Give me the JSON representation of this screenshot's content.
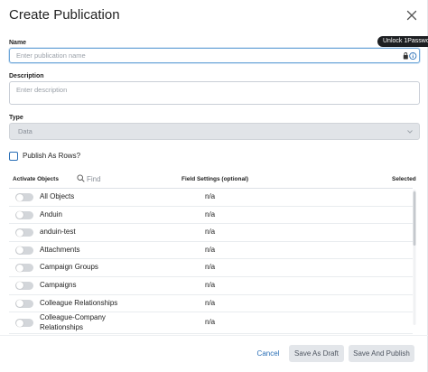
{
  "dialog": {
    "title": "Create Publication",
    "close_icon": "close-icon"
  },
  "name_field": {
    "label": "Name",
    "placeholder": "Enter publication name",
    "value": ""
  },
  "password_manager": {
    "tooltip": "Unlock 1Passwo",
    "icons": [
      "lock-icon",
      "info-icon"
    ]
  },
  "description_field": {
    "label": "Description",
    "placeholder": "Enter description",
    "value": ""
  },
  "type_field": {
    "label": "Type",
    "selected": "Data",
    "disabled": true
  },
  "publish_as_rows": {
    "label": "Publish As Rows?",
    "checked": false
  },
  "table": {
    "headers": {
      "activate": "Activate Objects",
      "find_placeholder": "Find",
      "field_settings": "Field Settings (optional)",
      "selected": "Selected"
    },
    "rows": [
      {
        "object": "All Objects",
        "field_settings": "n/a",
        "active": false
      },
      {
        "object": "Anduin",
        "field_settings": "n/a",
        "active": false
      },
      {
        "object": "anduin-test",
        "field_settings": "n/a",
        "active": false
      },
      {
        "object": "Attachments",
        "field_settings": "n/a",
        "active": false
      },
      {
        "object": "Campaign Groups",
        "field_settings": "n/a",
        "active": false
      },
      {
        "object": "Campaigns",
        "field_settings": "n/a",
        "active": false
      },
      {
        "object": "Colleague Relationships",
        "field_settings": "n/a",
        "active": false
      },
      {
        "object": "Colleague-Company Relationships",
        "field_settings": "n/a",
        "active": false
      }
    ]
  },
  "footer": {
    "cancel": "Cancel",
    "save_draft": "Save As Draft",
    "save_publish": "Save And Publish"
  },
  "colors": {
    "accent": "#2a6fb6",
    "button_bg": "#e3e6ea",
    "disabled_select": "#e1e4e8",
    "toggle_off": "#d3d6da"
  }
}
